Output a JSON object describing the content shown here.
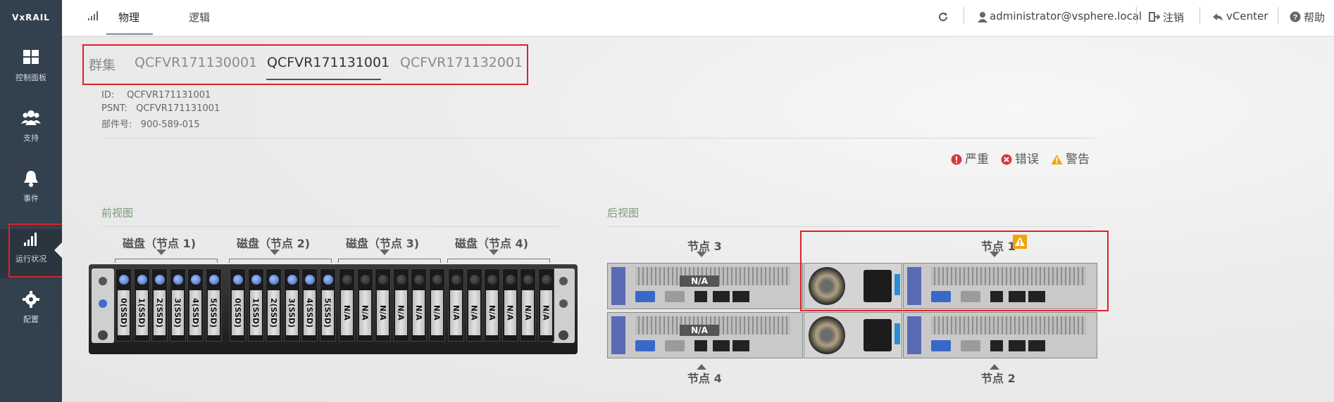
{
  "app": {
    "logo": "VxRAIL"
  },
  "sidebar": {
    "items": [
      {
        "label": "控制面板",
        "icon": "dashboard-grid-icon"
      },
      {
        "label": "支持",
        "icon": "users-icon"
      },
      {
        "label": "事件",
        "icon": "bell-icon"
      },
      {
        "label": "运行状况",
        "icon": "signal-bars-icon",
        "active": true
      },
      {
        "label": "配置",
        "icon": "gear-icon"
      }
    ]
  },
  "topbar": {
    "tabs": [
      "物理",
      "逻辑"
    ],
    "selected_tab": "物理",
    "user": "administrator@vsphere.local",
    "logout": "注销",
    "vcenter": "vCenter",
    "help": "帮助"
  },
  "content_tabs": {
    "items": [
      "群集",
      "QCFVR171130001",
      "QCFVR171131001",
      "QCFVR171132001"
    ],
    "selected": "QCFVR171131001"
  },
  "info": {
    "id_label": "ID:",
    "id_value": "QCFVR171131001",
    "psnt_label": "PSNT:",
    "psnt_value": "QCFVR171131001",
    "part_label": "部件号:",
    "part_value": "900-589-015"
  },
  "legend": {
    "critical": "严重",
    "error": "错误",
    "warning": "警告",
    "colors": {
      "critical": "#d9383a",
      "error": "#d9383a",
      "warning": "#f0a30a"
    }
  },
  "front_view": {
    "title": "前视图",
    "groups": [
      "磁盘（节点 1)",
      "磁盘（节点 2)",
      "磁盘（节点 3)",
      "磁盘（节点 4)"
    ],
    "disks_node1": [
      "0(SSD)",
      "1(SSD)",
      "2(SSD)",
      "3(SSD)",
      "4(SSD)",
      "5(SSD)"
    ],
    "disks_node2": [
      "0(SSD)",
      "1(SSD)",
      "2(SSD)",
      "3(SSD)",
      "4(SSD)",
      "5(SSD)"
    ],
    "disks_node3": [
      "N/A",
      "N/A",
      "N/A",
      "N/A",
      "N/A",
      "N/A"
    ],
    "disks_node4": [
      "N/A",
      "N/A",
      "N/A",
      "N/A",
      "N/A",
      "N/A"
    ]
  },
  "rear_view": {
    "title": "后视图",
    "node3": "节点 3",
    "node1": "节点 1",
    "node4": "节点 4",
    "node2": "节点 2",
    "na_label": "N/A"
  }
}
